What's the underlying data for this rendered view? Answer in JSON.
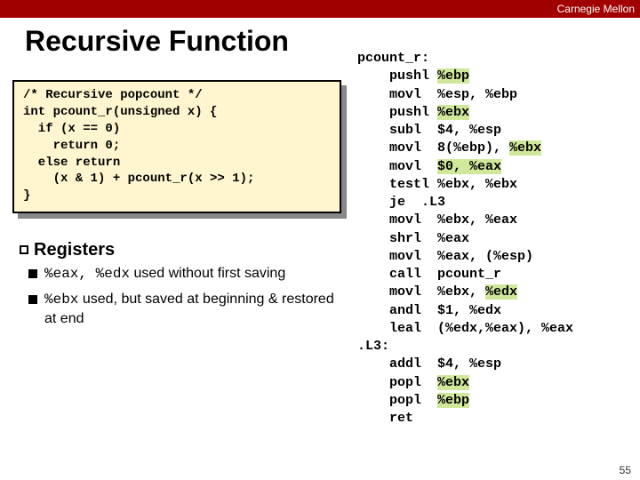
{
  "header": {
    "brand": "Carnegie Mellon"
  },
  "title": "Recursive Function",
  "c_code": "/* Recursive popcount */\nint pcount_r(unsigned x) {\n  if (x == 0)\n    return 0;\n  else return\n    (x & 1) + pcount_r(x >> 1);\n}",
  "registers": {
    "heading": "Registers",
    "items": [
      {
        "a": "%eax, %edx",
        "b": " used without first saving"
      },
      {
        "a": "%ebx",
        "b": " used, but saved at beginning & restored at end"
      }
    ]
  },
  "asm": {
    "label0": "pcount_r:",
    "l1a": "    pushl ",
    "l1b": "%ebp",
    "l2": "    movl  %esp, %ebp",
    "l3a": "    pushl ",
    "l3b": "%ebx",
    "l4": "    subl  $4, %esp",
    "l5a": "    movl  8(%ebp), ",
    "l5b": "%ebx",
    "l6a": "    movl  ",
    "l6b": "$0, %eax",
    "l7": "    testl %ebx, %ebx",
    "l8": "    je  .L3",
    "l9": "    movl  %ebx, %eax",
    "l10": "    shrl  %eax",
    "l11": "    movl  %eax, (%esp)",
    "l12": "    call  pcount_r",
    "l13a": "    movl  %ebx, ",
    "l13b": "%edx",
    "l14": "    andl  $1, %edx",
    "l15": "    leal  (%edx,%eax), %eax",
    "label1": ".L3:",
    "l16": "    addl  $4, %esp",
    "l17a": "    popl  ",
    "l17b": "%ebx",
    "l18a": "    popl  ",
    "l18b": "%ebp",
    "l19": "    ret"
  },
  "slidenum": "55"
}
